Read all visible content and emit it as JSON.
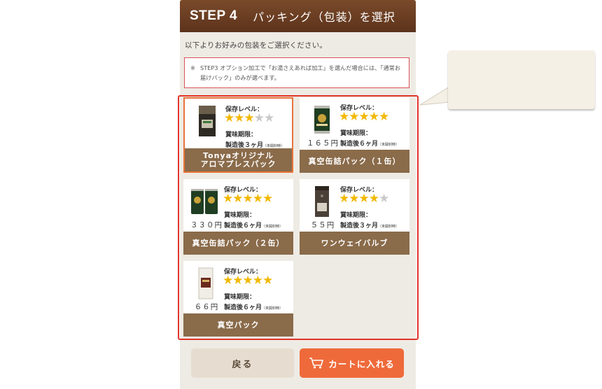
{
  "step": {
    "number": "STEP 4",
    "title": "パッキング（包装）を選択"
  },
  "instruction": "以下よりお好みの包装をご選択ください。",
  "note": {
    "mark": "※",
    "text": "STEP3 オプション加工で「お湯さえあれば加工」を選んだ場合には、「通常お届けパック」のみが選べます。"
  },
  "common": {
    "level_label": "保存レベル：",
    "expiry_label": "賞味期限：",
    "unopened": "（未開封時）",
    "star": "★"
  },
  "options": [
    {
      "name": "Tonyaオリジナル\nアロマプレスパック",
      "price": "",
      "rating": 3,
      "max_rating": 5,
      "expiry": "製造後３ヶ月",
      "selected": true,
      "image": "aroma-press-bag"
    },
    {
      "name": "真空缶詰パック（１缶）",
      "price": "１６５円",
      "rating": 5,
      "max_rating": 5,
      "expiry": "製造後６ヶ月",
      "selected": false,
      "image": "vacuum-can"
    },
    {
      "name": "真空缶詰パック（２缶）",
      "price": "３３０円",
      "rating": 5,
      "max_rating": 5,
      "expiry": "製造後６ヶ月",
      "selected": false,
      "image": "two-vacuum-cans"
    },
    {
      "name": "ワンウェイバルブ",
      "price": "５５円",
      "rating": 4,
      "max_rating": 5,
      "expiry": "製造後３ヶ月",
      "selected": false,
      "image": "one-way-valve-bag"
    },
    {
      "name": "真空パック",
      "price": "６６円",
      "rating": 5,
      "max_rating": 5,
      "expiry": "製造後６ヶ月",
      "selected": false,
      "image": "vacuum-bag"
    }
  ],
  "buttons": {
    "back": "戻る",
    "cart": "カートに入れる"
  },
  "colors": {
    "header": "#6a3d22",
    "accent": "#ef6a3a",
    "label_bg": "#8a6b4a",
    "highlight_border": "#e0352b",
    "star": "#f2b806"
  }
}
